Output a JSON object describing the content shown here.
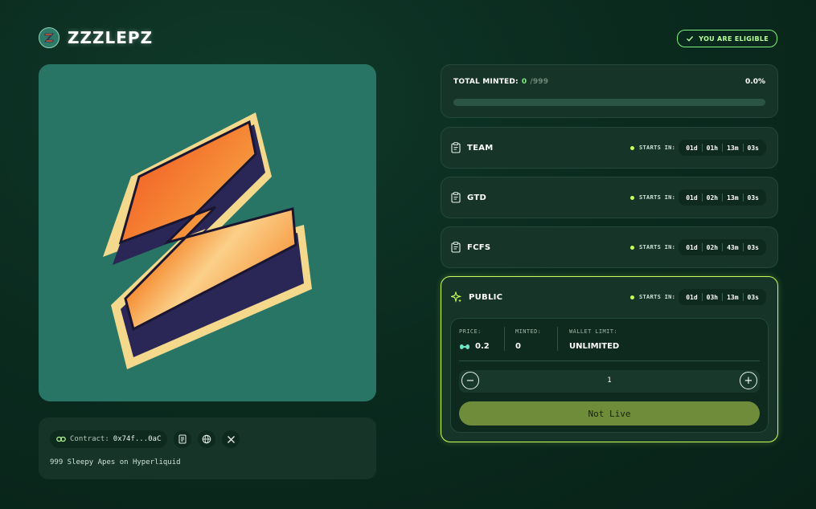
{
  "header": {
    "brand": "ZZZLEPZ",
    "eligible_label": "YOU ARE ELIGIBLE"
  },
  "contract": {
    "label": "Contract:",
    "address": "0x74f...0aC",
    "description": "999 Sleepy Apes on Hyperliquid"
  },
  "total": {
    "label": "TOTAL MINTED:",
    "minted": "0",
    "max": "/999",
    "percent": "0.0%",
    "progress_fraction": 0.0
  },
  "phases": [
    {
      "name": "TEAM",
      "starts_label": "STARTS IN:",
      "d": "01d",
      "h": "01h",
      "m": "13m",
      "s": "03s"
    },
    {
      "name": "GTD",
      "starts_label": "STARTS IN:",
      "d": "01d",
      "h": "02h",
      "m": "13m",
      "s": "03s"
    },
    {
      "name": "FCFS",
      "starts_label": "STARTS IN:",
      "d": "01d",
      "h": "02h",
      "m": "43m",
      "s": "03s"
    }
  ],
  "public": {
    "name": "PUBLIC",
    "starts_label": "STARTS IN:",
    "d": "01d",
    "h": "03h",
    "m": "13m",
    "s": "03s",
    "price_label": "PRICE:",
    "price": "0.2",
    "minted_label": "MINTED:",
    "minted": "0",
    "wallet_limit_label": "WALLET LIMIT:",
    "wallet_limit": "UNLIMITED",
    "minus": "−",
    "plus": "+",
    "quantity": "1",
    "button_label": "Not Live"
  },
  "colors": {
    "accent_green": "#7df07d",
    "accent_lime": "#c9ff5a",
    "button": "#6f8c3b",
    "art_bg": "#287565"
  },
  "icons": [
    "zzzlepz-logo-icon",
    "check-icon",
    "link-icon",
    "contract-doc-icon",
    "globe-icon",
    "x-icon",
    "clipboard-icon",
    "sparkle-icon",
    "hyperliquid-icon"
  ]
}
